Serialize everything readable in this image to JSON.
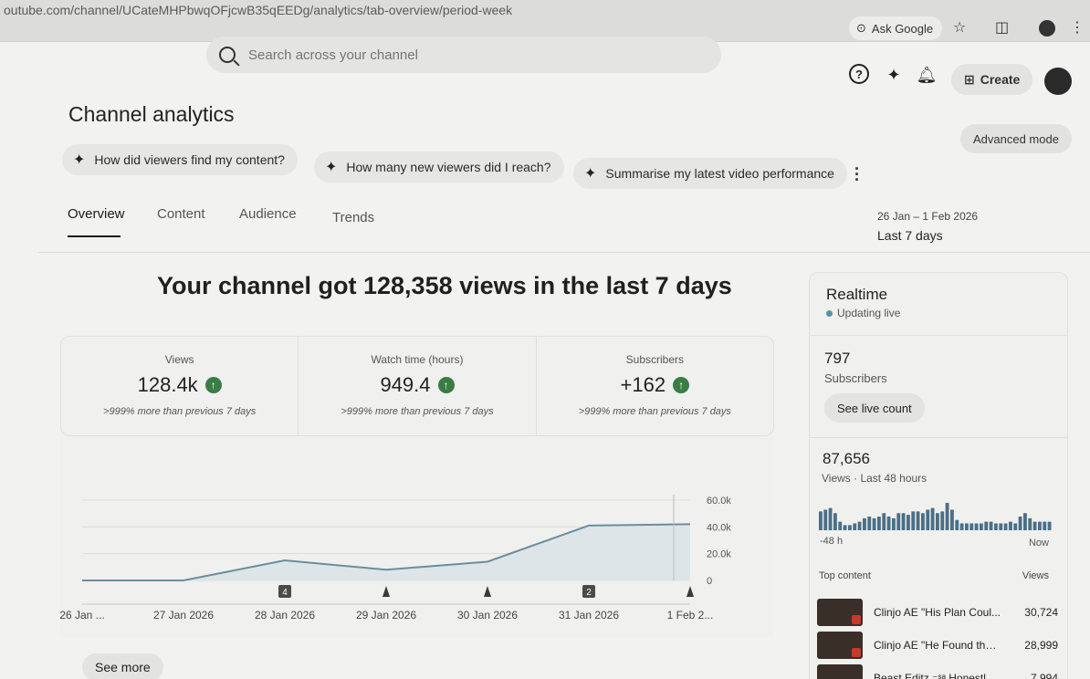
{
  "browser": {
    "url": "outube.com/channel/UCateMHPbwqOFjcwB35qEEDg/analytics/tab-overview/period-week",
    "ask_google": "Ask Google"
  },
  "header": {
    "search_placeholder": "Search across your channel",
    "create_label": "Create"
  },
  "page": {
    "title": "Channel analytics",
    "advanced_mode": "Advanced mode",
    "chips": [
      "How did viewers find my content?",
      "How many new viewers did I reach?",
      "Summarise my latest video performance"
    ],
    "tabs": [
      "Overview",
      "Content",
      "Audience",
      "Trends"
    ],
    "date_range": "26 Jan – 1 Feb 2026",
    "period": "Last 7 days",
    "headline": "Your channel got 128,358 views in the last 7 days"
  },
  "kpis": [
    {
      "label": "Views",
      "value": "128.4k",
      "compare": ">999% more than previous 7 days"
    },
    {
      "label": "Watch time (hours)",
      "value": "949.4",
      "compare": ">999% more than previous 7 days"
    },
    {
      "label": "Subscribers",
      "value": "+162",
      "compare": ">999% more than previous 7 days"
    }
  ],
  "see_more": "See more",
  "chart_data": {
    "type": "area",
    "x": [
      "26 Jan ...",
      "27 Jan 2026",
      "28 Jan 2026",
      "29 Jan 2026",
      "30 Jan 2026",
      "31 Jan 2026",
      "1 Feb 2..."
    ],
    "series": [
      {
        "values": [
          0,
          0,
          15000,
          8000,
          14000,
          41000,
          42000
        ]
      }
    ],
    "yticks": [
      "0",
      "20.0k",
      "40.0k",
      "60.0k"
    ],
    "ylim": [
      0,
      60000
    ],
    "markers": [
      {
        "x_index": 2,
        "label": "4"
      },
      {
        "x_index": 3,
        "label": ""
      },
      {
        "x_index": 4,
        "label": ""
      },
      {
        "x_index": 5,
        "label": "2"
      },
      {
        "x_index": 6,
        "label": ""
      }
    ]
  },
  "realtime": {
    "title": "Realtime",
    "status": "Updating live",
    "subscribers": "797",
    "subscribers_label": "Subscribers",
    "live_count_btn": "See live count",
    "views": "87,656",
    "views_label": "Views · Last 48 hours",
    "axis_left": "-48 h",
    "axis_right": "Now",
    "hourly_views": [
      22,
      24,
      26,
      20,
      10,
      6,
      6,
      8,
      10,
      14,
      16,
      14,
      16,
      20,
      16,
      14,
      20,
      20,
      18,
      22,
      22,
      20,
      24,
      26,
      20,
      22,
      32,
      24,
      12,
      8,
      8,
      8,
      8,
      8,
      10,
      10,
      8,
      8,
      8,
      10,
      8,
      16,
      20,
      14,
      10,
      10,
      10,
      10
    ],
    "top_content_label": "Top content",
    "views_col_label": "Views",
    "top_content": [
      {
        "title": "Clinjo AE \"His Plan Coul...",
        "views": "30,724"
      },
      {
        "title": "Clinjo AE \"He Found the ...",
        "views": "28,999"
      },
      {
        "title": "Beast Editz ⁻ˢᵃ Honestly, I...",
        "views": "7,994"
      }
    ]
  }
}
